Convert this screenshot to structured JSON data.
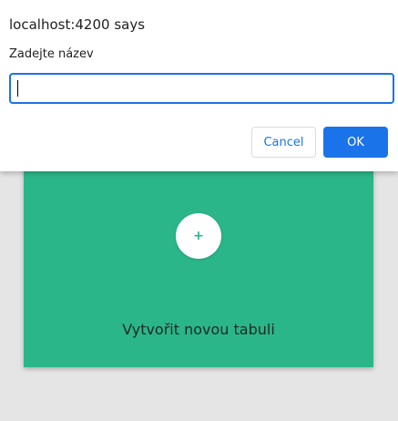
{
  "dialog": {
    "title": "localhost:4200 says",
    "message": "Zadejte název",
    "input_value": "",
    "cancel_label": "Cancel",
    "ok_label": "OK"
  },
  "card": {
    "add_icon": "+",
    "label": "Vytvořit novou tabuli"
  },
  "colors": {
    "card_background": "#2bb68a",
    "page_background": "#e5e5e5",
    "accent": "#1a73e8"
  }
}
